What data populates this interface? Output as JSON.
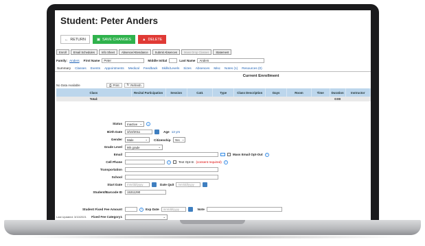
{
  "page": {
    "title": "Student: Peter Anders",
    "buttons": {
      "return": "RETURN",
      "save": "SAVE CHANGES",
      "delete": "DELETE"
    },
    "top_actions": [
      "Enroll",
      "Email Schedules",
      "Info Sheet",
      "Absence/Attendance",
      "Submit Absences",
      "Mass Drop Classes",
      "Statement"
    ],
    "family": {
      "label": "Family:",
      "value": "Anders"
    },
    "first_name": {
      "label": "First Name",
      "value": "Peter"
    },
    "middle_initial": {
      "label": "Middle Initial",
      "value": ""
    },
    "last_name": {
      "label": "Last Name",
      "value": "Anders"
    },
    "tabs": [
      "Summary",
      "Classes",
      "Events",
      "Appointments",
      "Medical",
      "Feedback",
      "Skills/Levels",
      "Sizes",
      "Absences",
      "Misc",
      "Notes (1)",
      "Resources (0)"
    ],
    "enrollment": {
      "title": "Current Enrollment",
      "no_data": "No Data Available",
      "print": "Print",
      "refresh": "Refresh",
      "columns": [
        "Class",
        "Recital Participation",
        "Session",
        "Cat1",
        "Type",
        "Class Description",
        "Days",
        "Room",
        "Time",
        "Duration",
        "Instructor"
      ],
      "total_label": "Total:",
      "total_duration": "0:00"
    },
    "form": {
      "status": {
        "label": "Status",
        "value": "Inactive"
      },
      "birth_date": {
        "label": "Birth Date",
        "value": "3/10/2011",
        "age_label": "Age",
        "age_value": "13 yrs"
      },
      "gender": {
        "label": "Gender",
        "value": "Male",
        "citizenship_label": "Citizenship",
        "citizenship_value": "Yes"
      },
      "grade_level": {
        "label": "Grade Level",
        "value": "9th grade"
      },
      "email": {
        "label": "Email",
        "value": "",
        "optout": "Mass Email Opt-Out"
      },
      "cell_phone": {
        "label": "Cell Phone",
        "value": "",
        "textopt": "Text Opt-In",
        "consent": "(consent required)"
      },
      "transportation": {
        "label": "Transportation",
        "value": ""
      },
      "school": {
        "label": "School",
        "value": ""
      },
      "start_date": {
        "label": "Start Date",
        "placeholder": "mm/dd/yyyy",
        "quit_label": "Date Quit",
        "quit_placeholder": "mm/dd/yyyy"
      },
      "barcode": {
        "label": "Student/Barcode ID",
        "value": "15311290"
      },
      "fixed_fee": {
        "label": "Student Fixed Fee Amount",
        "exp_label": "Exp Date",
        "exp_placeholder": "mm/dd/yyyy",
        "note_label": "Note"
      },
      "fee_category": {
        "label": "Fixed Fee Category1",
        "value": ""
      }
    },
    "last_updated": "Last Updated: 3/10/2021"
  },
  "colors": {
    "green": "#2fb24c",
    "red": "#e03a35",
    "grid_header": "#bcd6ec",
    "link": "#1a5fb4"
  }
}
